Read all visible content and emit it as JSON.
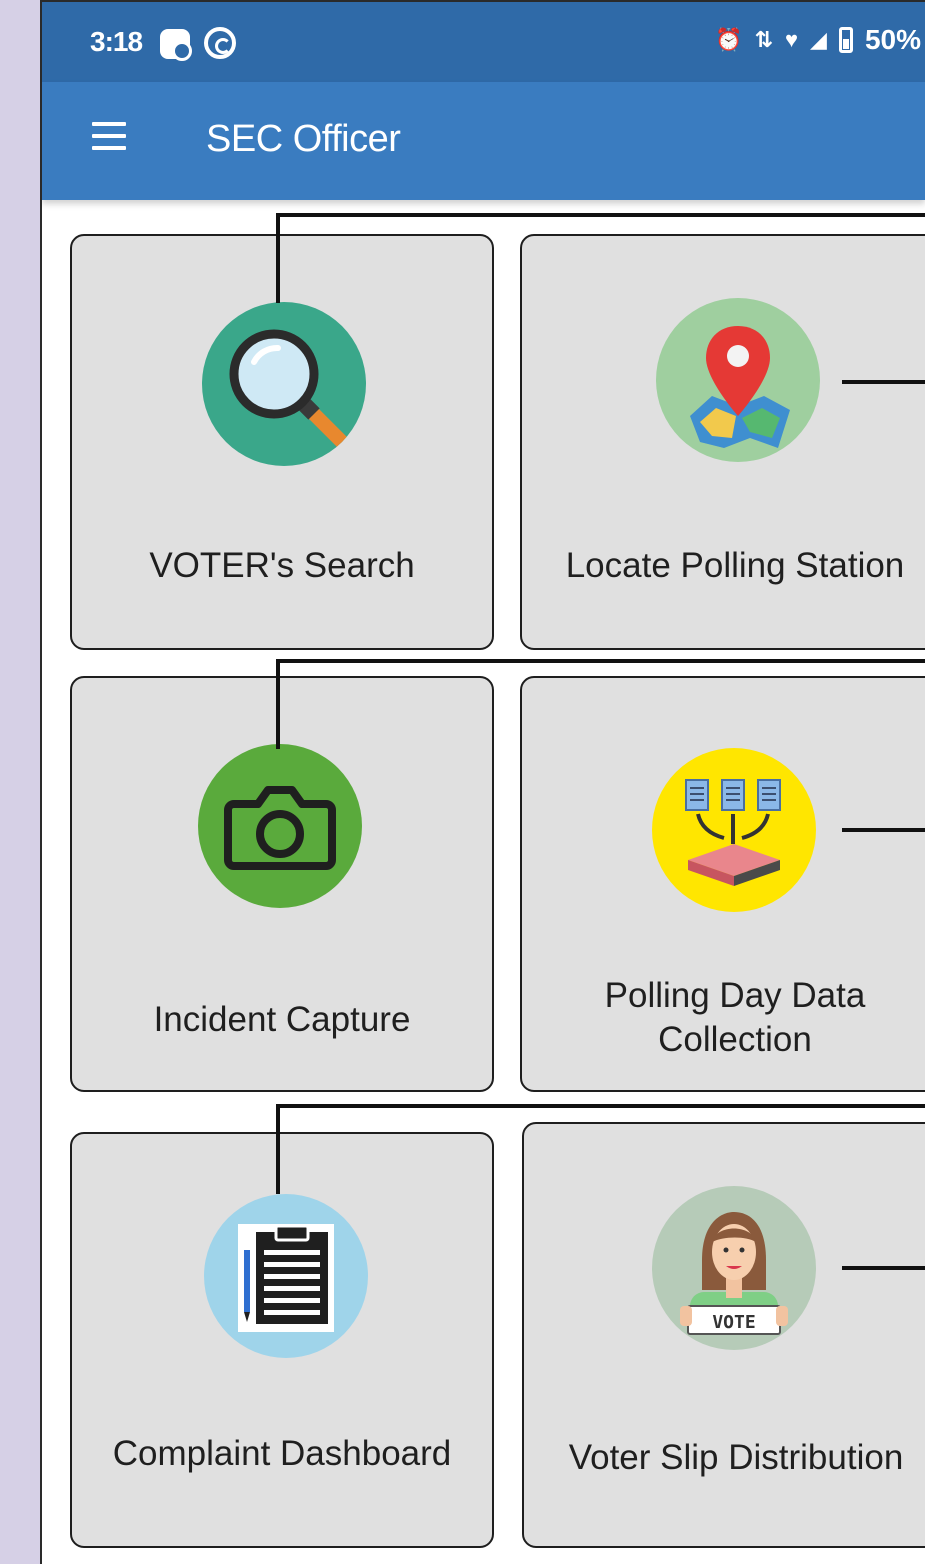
{
  "status_bar": {
    "time": "3:18",
    "battery": "50%"
  },
  "app_bar": {
    "title": "SEC Officer"
  },
  "tiles": [
    {
      "label": "VOTER's Search",
      "icon": "magnifier-icon"
    },
    {
      "label": "Locate Polling Station",
      "icon": "map-pin-icon"
    },
    {
      "label": "Incident Capture",
      "icon": "camera-icon"
    },
    {
      "label": "Polling Day Data Collection",
      "icon": "data-collection-icon"
    },
    {
      "label": "Complaint Dashboard",
      "icon": "clipboard-icon"
    },
    {
      "label": "Voter Slip Distribution",
      "icon": "voter-vote-sign-icon"
    }
  ],
  "icon_text": {
    "vote_sign": "VOTE"
  },
  "colors": {
    "status_bar": "#2f6aa8",
    "app_bar": "#3a7cc0",
    "card_bg": "#e0e0e0",
    "search_icon_bg": "#3aa78a",
    "map_icon_bg": "#9fcf9f",
    "camera_icon_bg": "#5aaa3c",
    "data_icon_bg": "#ffe600",
    "clipboard_icon_bg": "#9fd4ea",
    "vote_icon_bg": "#b6cbb8"
  }
}
